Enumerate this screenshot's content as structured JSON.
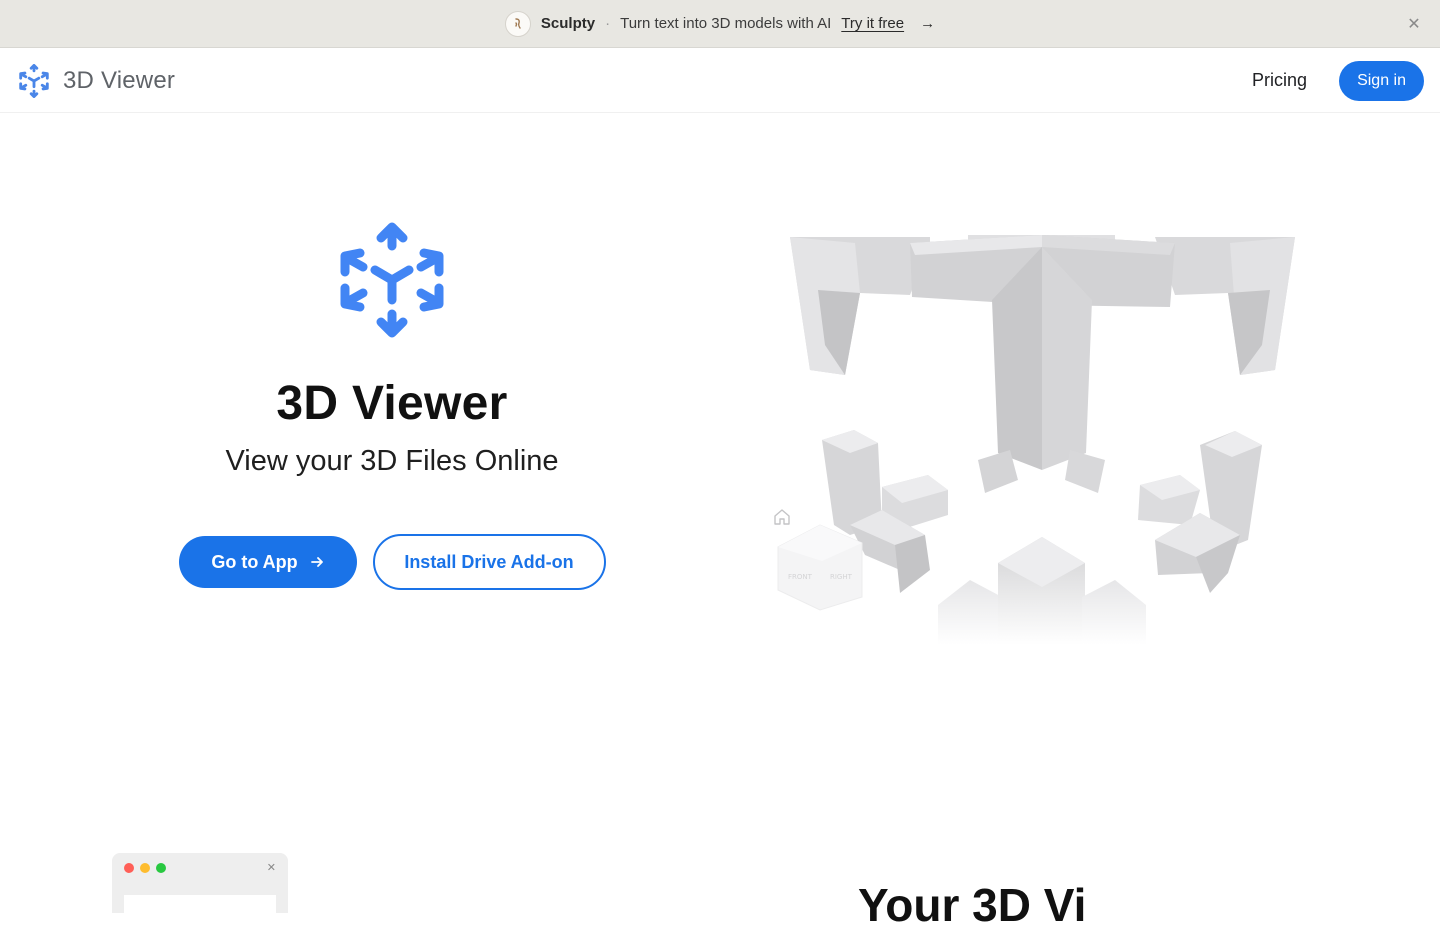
{
  "banner": {
    "brand": "Sculpty",
    "separator": "·",
    "message": "Turn text into 3D models with AI",
    "link": "Try it free",
    "arrow": "→",
    "close": "✕"
  },
  "header": {
    "app_name": "3D Viewer",
    "nav": {
      "pricing": "Pricing",
      "signin": "Sign in"
    }
  },
  "hero": {
    "title": "3D Viewer",
    "subtitle": "View your 3D Files Online",
    "primary_button": "Go to App",
    "secondary_button": "Install Drive Add-on"
  },
  "viewer": {
    "cube_labels": {
      "front": "FRONT",
      "right": "RIGHT"
    }
  },
  "next_section": {
    "heading": "Your 3D Vi"
  },
  "colors": {
    "accent": "#1a73e8",
    "logo_blue": "#4285f4",
    "banner_bg": "#e8e7e2"
  },
  "icons": [
    "sculpty-logo-icon",
    "close-icon",
    "viewer-logo-icon",
    "arrow-right-icon",
    "home-icon"
  ]
}
